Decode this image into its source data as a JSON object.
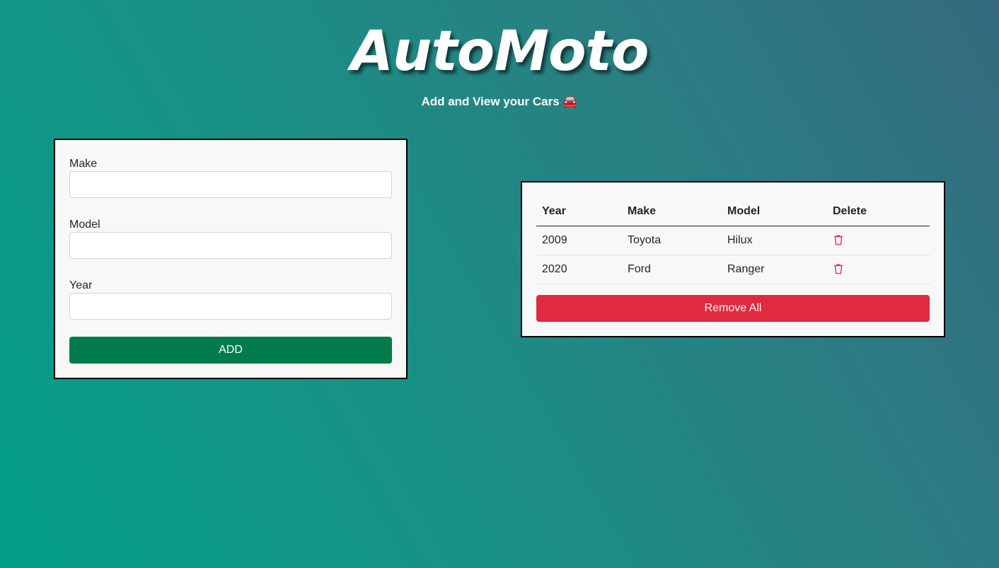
{
  "header": {
    "title": "AutoMoto",
    "subtitle": "Add and View your Cars 🚘"
  },
  "form": {
    "fields": [
      {
        "label": "Make",
        "value": ""
      },
      {
        "label": "Model",
        "value": ""
      },
      {
        "label": "Year",
        "value": ""
      }
    ],
    "add_label": "ADD"
  },
  "table": {
    "headers": [
      "Year",
      "Make",
      "Model",
      "Delete"
    ],
    "rows": [
      {
        "year": "2009",
        "make": "Toyota",
        "model": "Hilux",
        "delete_icon": "trash-icon"
      },
      {
        "year": "2020",
        "make": "Ford",
        "model": "Ranger",
        "delete_icon": "trash-icon"
      }
    ],
    "remove_all_label": "Remove All"
  },
  "colors": {
    "add_button": "#007c4c",
    "remove_button": "#e02a3f",
    "delete_icon": "#e02a3f"
  }
}
